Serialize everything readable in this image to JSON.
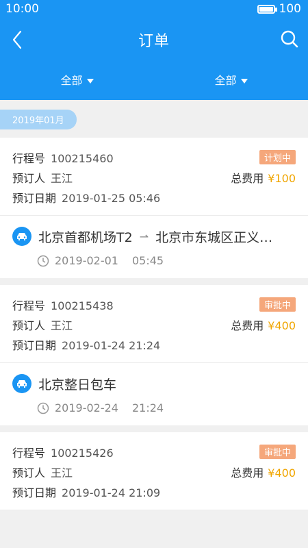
{
  "status": {
    "time": "10:00",
    "battery": "100",
    "battery_level": 1.0
  },
  "nav": {
    "title": "订单"
  },
  "filters": [
    {
      "label": "全部"
    },
    {
      "label": "全部"
    }
  ],
  "month": "2019年01月",
  "orders": [
    {
      "trip_label": "行程号",
      "trip_no": "100215460",
      "status": "计划中",
      "booker_label": "预订人",
      "booker": "王江",
      "total_label": "总费用",
      "total": "¥100",
      "date_label": "预订日期",
      "date": "2019-01-25 05:46",
      "route_from": "北京首都机场T2",
      "route_to": "北京市东城区正义…",
      "ride_date": "2019-02-01",
      "ride_time": "05:45"
    },
    {
      "trip_label": "行程号",
      "trip_no": "100215438",
      "status": "审批中",
      "booker_label": "预订人",
      "booker": "王江",
      "total_label": "总费用",
      "total": "¥400",
      "date_label": "预订日期",
      "date": "2019-01-24 21:24",
      "route_title": "北京整日包车",
      "ride_date": "2019-02-24",
      "ride_time": "21:24"
    },
    {
      "trip_label": "行程号",
      "trip_no": "100215426",
      "status": "审批中",
      "booker_label": "预订人",
      "booker": "王江",
      "total_label": "总费用",
      "total": "¥400",
      "date_label": "预订日期",
      "date": "2019-01-24 21:09"
    }
  ],
  "colors": {
    "primary": "#1a95f3",
    "badge": "#f5a77b",
    "price": "#f0a500"
  }
}
